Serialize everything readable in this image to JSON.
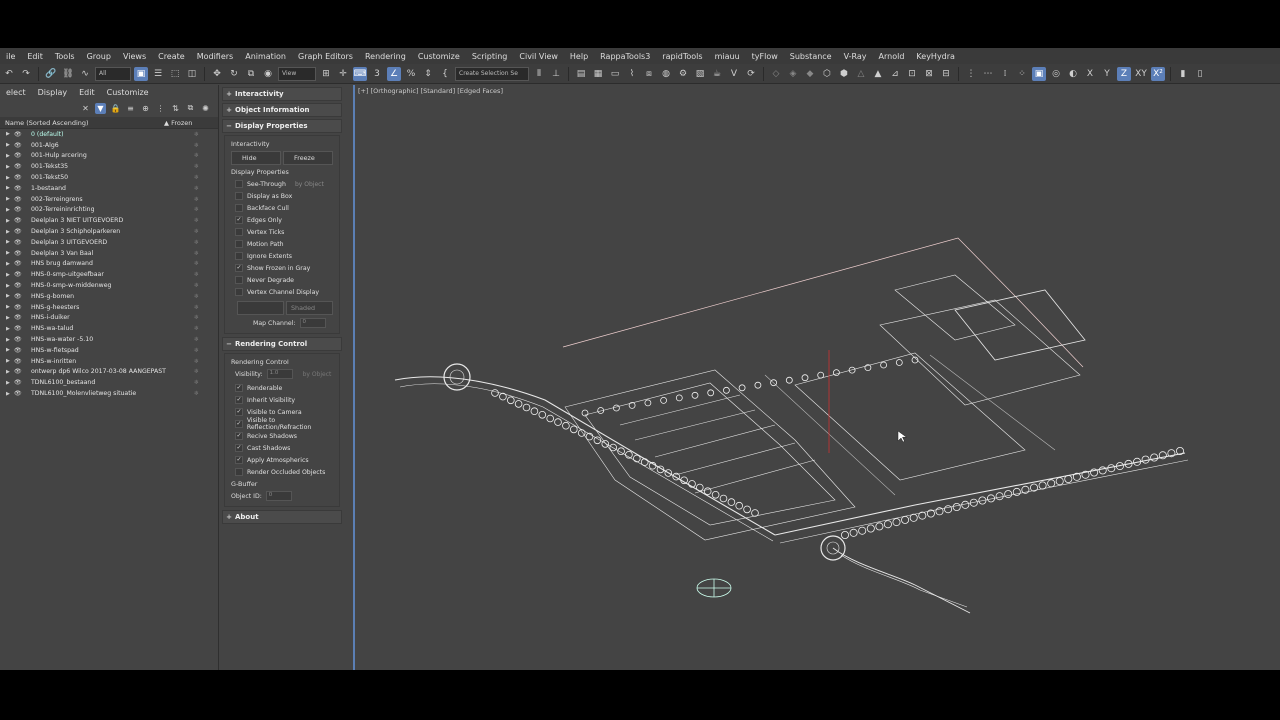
{
  "menubar": [
    "ile",
    "Edit",
    "Tools",
    "Group",
    "Views",
    "Create",
    "Modifiers",
    "Animation",
    "Graph Editors",
    "Rendering",
    "Customize",
    "Scripting",
    "Civil View",
    "Help",
    "RappaTools3",
    "rapidTools",
    "miauu",
    "tyFlow",
    "Substance",
    "V-Ray",
    "Arnold",
    "KeyHydra"
  ],
  "toolbar": {
    "filter_value": "All",
    "view_value": "View",
    "selection_set_placeholder": "Create Selection Se"
  },
  "layer_panel": {
    "menu": [
      "elect",
      "Display",
      "Edit",
      "Customize"
    ],
    "column_name": "Name (Sorted Ascending)",
    "column_frozen": "▲ Frozen",
    "layers": [
      "0 (default)",
      "001-Alg6",
      "001-Hulp arcering",
      "001-Tekst35",
      "001-Tekst50",
      "1-bestaand",
      "002-Terreingrens",
      "002-Terreininrichting",
      "Deelplan 3 NIET UITGEVOERD",
      "Deelplan 3 Schipholparkeren",
      "Deelplan 3 UITGEVOERD",
      "Deelplan 3 Van Baal",
      "HNS brug damwand",
      "HNS-0-smp-uitgeefbaar",
      "HNS-0-smp-w-middenweg",
      "HNS-g-bomen",
      "HNS-g-heesters",
      "HNS-i-duiker",
      "HNS-wa-talud",
      "HNS-wa-water -5.10",
      "HNS-w-fietspad",
      "HNS-w-inritten",
      "ontwerp dp6 Wilco 2017-03-08 AANGEPAST",
      "TDNL6100_bestaand",
      "TDNL6100_Molenvlietweg situatie"
    ]
  },
  "command_panel": {
    "rollouts": {
      "interactivity": "Interactivity",
      "object_information": "Object Information",
      "display_properties": "Display Properties",
      "rendering_control": "Rendering Control",
      "about": "About"
    },
    "interactivity_label": "Interactivity",
    "hide_label": "Hide",
    "freeze_label": "Freeze",
    "display_props_label": "Display Properties",
    "display_checks": [
      {
        "label": "See-Through",
        "checked": false
      },
      {
        "label": "Display as Box",
        "checked": false
      },
      {
        "label": "Backface Cull",
        "checked": false
      },
      {
        "label": "Edges Only",
        "checked": true
      },
      {
        "label": "Vertex Ticks",
        "checked": false
      },
      {
        "label": "Motion Path",
        "checked": false
      },
      {
        "label": "Ignore Extents",
        "checked": false
      },
      {
        "label": "Show Frozen in Gray",
        "checked": true
      },
      {
        "label": "Never Degrade",
        "checked": false
      },
      {
        "label": "Vertex Channel Display",
        "checked": false
      }
    ],
    "by_object": "by Object",
    "shaded": "Shaded",
    "map_channel_label": "Map Channel:",
    "map_channel_value": "0",
    "rendering_control_label": "Rendering Control",
    "visibility_label": "Visibility:",
    "visibility_value": "1.0",
    "render_checks": [
      {
        "label": "Renderable",
        "checked": true
      },
      {
        "label": "Inherit Visibility",
        "checked": true
      },
      {
        "label": "Visible to Camera",
        "checked": true
      },
      {
        "label": "Visible to Reflection/Refraction",
        "checked": true
      },
      {
        "label": "Recive Shadows",
        "checked": true
      },
      {
        "label": "Cast Shadows",
        "checked": true
      },
      {
        "label": "Apply Atmospherics",
        "checked": true
      },
      {
        "label": "Render Occluded Objects",
        "checked": false
      }
    ],
    "gbuffer_label": "G-Buffer",
    "object_id_label": "Object ID:",
    "object_id_value": "0"
  },
  "viewport": {
    "label": "[+] [Orthographic] [Standard] [Edged Faces]"
  },
  "colors": {
    "ui_bg": "#444444",
    "viewport_border": "#5b7fb4",
    "active_tool": "#5c7fb8"
  }
}
